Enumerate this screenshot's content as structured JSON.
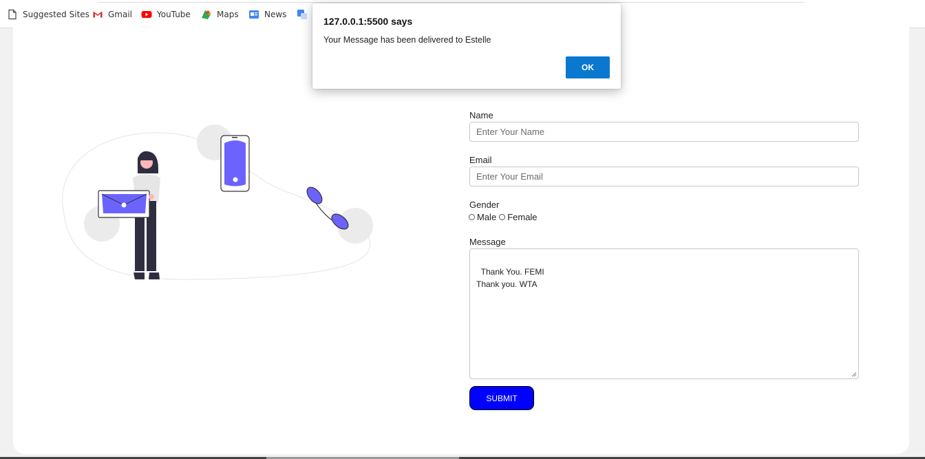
{
  "bookmarks": [
    {
      "label": "Suggested Sites",
      "icon": "page-icon"
    },
    {
      "label": "Gmail",
      "icon": "gmail-icon"
    },
    {
      "label": "YouTube",
      "icon": "youtube-icon"
    },
    {
      "label": "Maps",
      "icon": "maps-icon"
    },
    {
      "label": "News",
      "icon": "news-icon"
    },
    {
      "label": "",
      "icon": "translate-icon"
    }
  ],
  "form": {
    "name_label": "Name",
    "name_placeholder": "Enter Your Name",
    "email_label": "Email",
    "email_placeholder": "Enter Your Email",
    "gender_label": "Gender",
    "gender_options": [
      "Male",
      "Female"
    ],
    "message_label": "Message",
    "message_value": "Thank You. FEMI\nThank you. WTA",
    "submit_label": "SUBMIT"
  },
  "dialog": {
    "title": "127.0.0.1:5500 says",
    "message": "Your Message has been delivered to Estelle",
    "ok_label": "OK"
  },
  "colors": {
    "accent": "#6c63ff",
    "submit": "#0000ff",
    "ok_button": "#0b78d0"
  }
}
